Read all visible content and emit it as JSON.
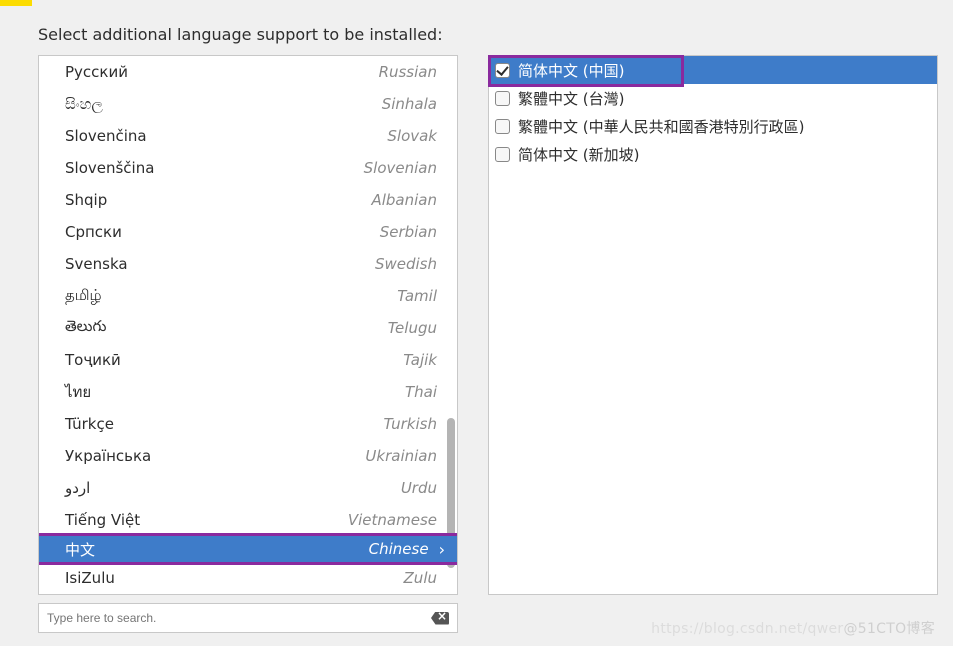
{
  "header": "Select additional language support to be installed:",
  "search_placeholder": "Type here to search.",
  "languages": [
    {
      "native": "Русский",
      "english": "Russian"
    },
    {
      "native": "සිංහල",
      "english": "Sinhala"
    },
    {
      "native": "Slovenčina",
      "english": "Slovak"
    },
    {
      "native": "Slovenščina",
      "english": "Slovenian"
    },
    {
      "native": "Shqip",
      "english": "Albanian"
    },
    {
      "native": "Српски",
      "english": "Serbian"
    },
    {
      "native": "Svenska",
      "english": "Swedish"
    },
    {
      "native": "தமிழ்",
      "english": "Tamil"
    },
    {
      "native": "తెలుగు",
      "english": "Telugu"
    },
    {
      "native": "Тоҷикӣ",
      "english": "Tajik"
    },
    {
      "native": "ไทย",
      "english": "Thai"
    },
    {
      "native": "Türkçe",
      "english": "Turkish"
    },
    {
      "native": "Українська",
      "english": "Ukrainian"
    },
    {
      "native": "اردو",
      "english": "Urdu"
    },
    {
      "native": "Tiếng Việt",
      "english": "Vietnamese"
    },
    {
      "native": "中文",
      "english": "Chinese",
      "selected": true
    },
    {
      "native": "IsiZulu",
      "english": "Zulu"
    }
  ],
  "variants": [
    {
      "label": "简体中文 (中国)",
      "checked": true,
      "selected": true
    },
    {
      "label": "繁體中文 (台灣)",
      "checked": false
    },
    {
      "label": "繁體中文 (中華人民共和國香港特別行政區)",
      "checked": false
    },
    {
      "label": "简体中文 (新加坡)",
      "checked": false
    }
  ],
  "watermark": {
    "left": "https://blog.csdn.net/qwer",
    "right": "@51CTO博客"
  }
}
